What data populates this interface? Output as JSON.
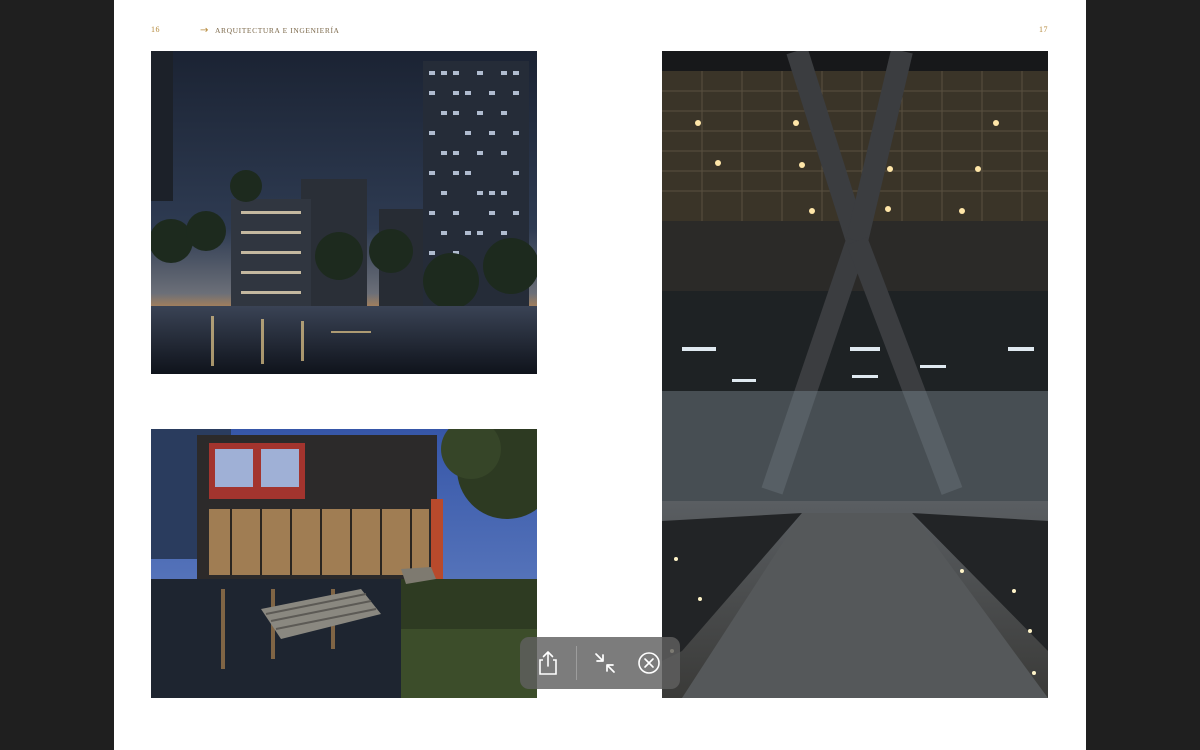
{
  "spread": {
    "left_page_number": "16",
    "right_page_number": "17",
    "running_head_arrow": "→",
    "running_head_title": "ARQUITECTURA E INGENIERÍA"
  },
  "colors": {
    "viewer_background": "#1f1f1f",
    "page": "#ffffff",
    "accent_gold": "#b58a3c",
    "toolbar": "#5f5f5f"
  },
  "photos": [
    {
      "id": "tower",
      "subject": "night tower and courtyard pool"
    },
    {
      "id": "pavilion",
      "subject": "glass pavilion with garden bench at dusk"
    },
    {
      "id": "atrium",
      "subject": "lobby atrium with steel X-columns and glass walkway"
    }
  ],
  "toolbar": {
    "share_icon": "share-icon",
    "collapse_icon": "collapse-icon",
    "close_icon": "close-circle-icon"
  }
}
